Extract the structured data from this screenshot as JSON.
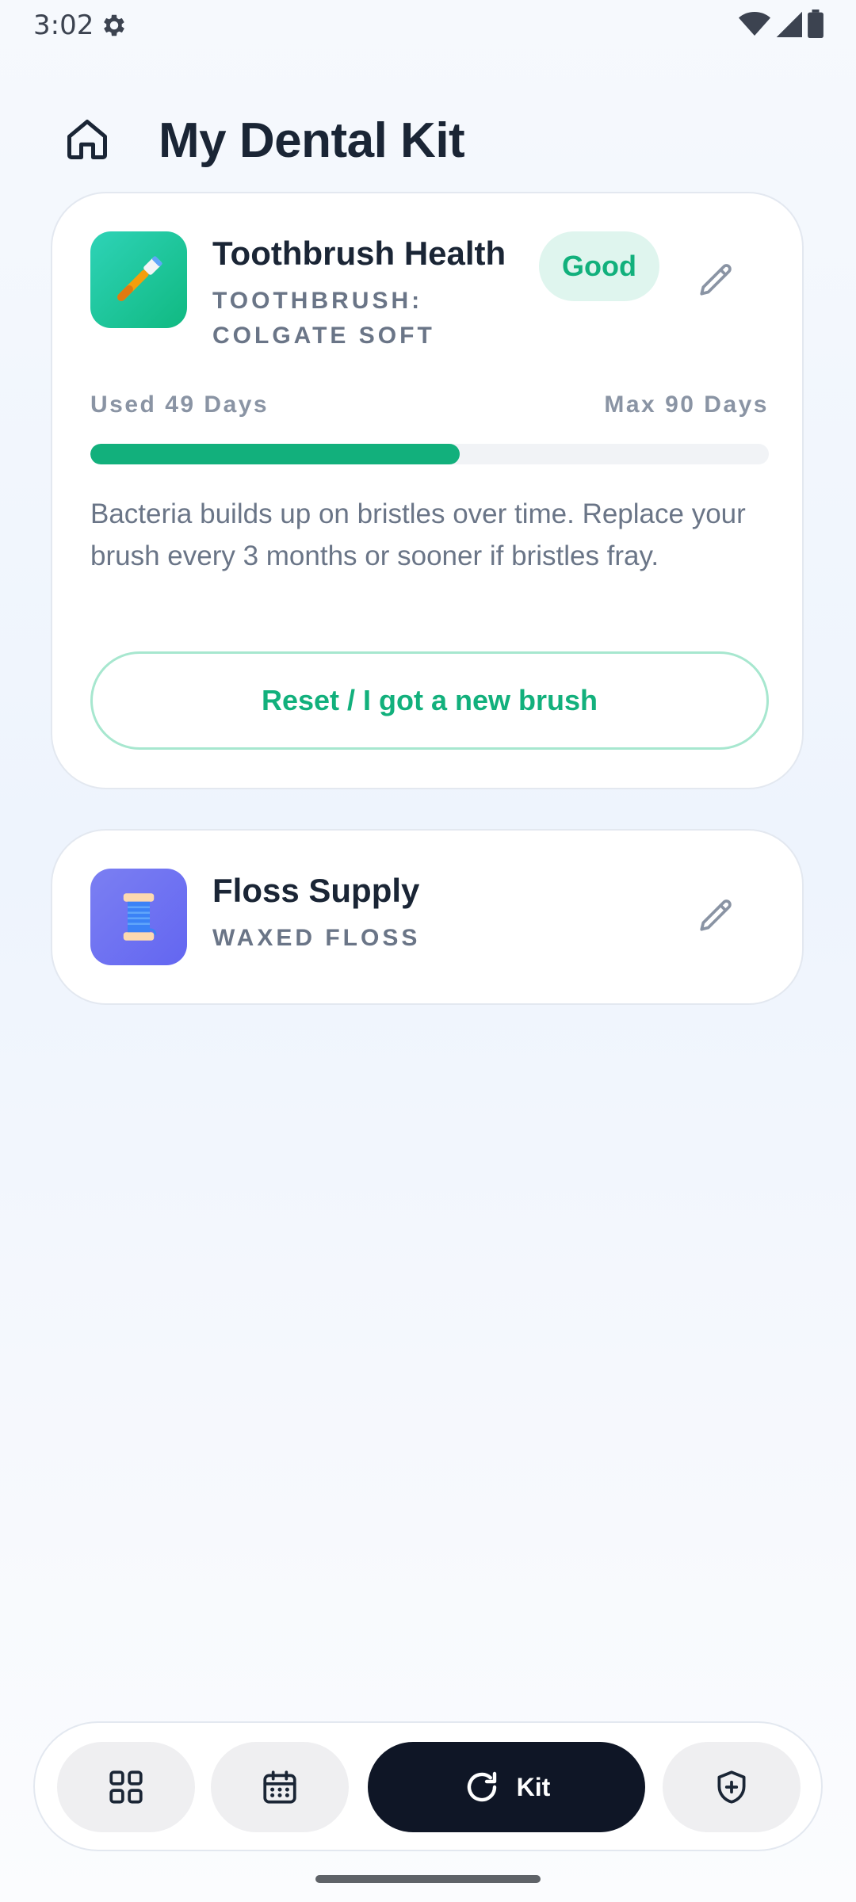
{
  "status_bar": {
    "time": "3:02"
  },
  "header": {
    "title": "My Dental Kit"
  },
  "toothbrush_card": {
    "title": "Toothbrush Health",
    "subtitle_line1": "TOOTHBRUSH:",
    "subtitle_line2": "COLGATE SOFT",
    "badge": "Good",
    "used_label": "Used 49 Days",
    "max_label": "Max 90 Days",
    "progress_fraction": 0.544,
    "description": "Bacteria builds up on bristles over time. Replace your brush every 3 months or sooner if bristles fray.",
    "reset_button": "Reset / I got a new brush"
  },
  "floss_card": {
    "title": "Floss Supply",
    "subtitle": "WAXED FLOSS"
  },
  "nav": {
    "active_label": "Kit",
    "items": [
      "grid-icon",
      "calendar-icon",
      "refresh-icon",
      "shield-plus-icon"
    ]
  },
  "colors": {
    "accent": "#12b07c",
    "nav_active": "#0f1626",
    "floss": "#6366f1"
  }
}
